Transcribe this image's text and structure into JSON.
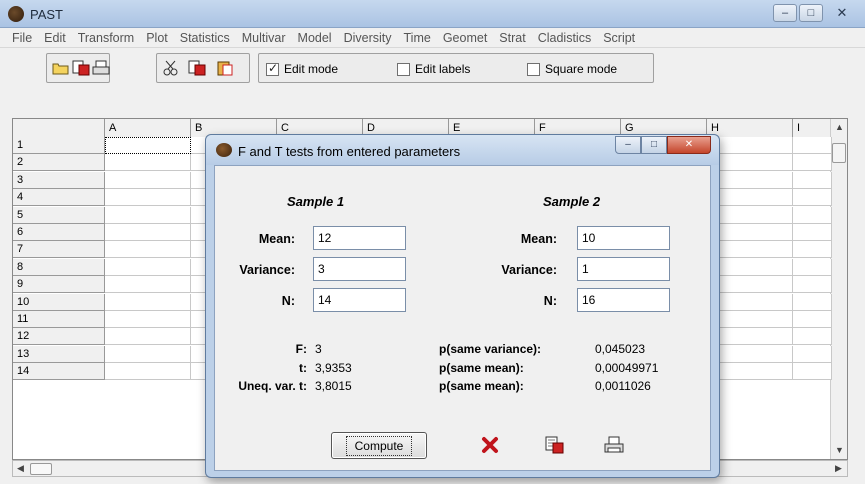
{
  "window": {
    "title": "PAST"
  },
  "menu": [
    "File",
    "Edit",
    "Transform",
    "Plot",
    "Statistics",
    "Multivar",
    "Model",
    "Diversity",
    "Time",
    "Geomet",
    "Strat",
    "Cladistics",
    "Script"
  ],
  "toolbar": {
    "edit_mode": {
      "label": "Edit mode",
      "checked": true
    },
    "edit_labels": {
      "label": "Edit labels",
      "checked": false
    },
    "square_mode": {
      "label": "Square mode",
      "checked": false
    }
  },
  "grid": {
    "columns": [
      "A",
      "B",
      "C",
      "D",
      "E",
      "F",
      "G",
      "H",
      "I"
    ],
    "rows": [
      "1",
      "2",
      "3",
      "4",
      "5",
      "6",
      "7",
      "8",
      "9",
      "10",
      "11",
      "12",
      "13",
      "14"
    ]
  },
  "dialog": {
    "title": "F and T tests from entered parameters",
    "sample1": {
      "header": "Sample 1",
      "mean_label": "Mean:",
      "mean": "12",
      "variance_label": "Variance:",
      "variance": "3",
      "n_label": "N:",
      "n": "14"
    },
    "sample2": {
      "header": "Sample 2",
      "mean_label": "Mean:",
      "mean": "10",
      "variance_label": "Variance:",
      "variance": "1",
      "n_label": "N:",
      "n": "16"
    },
    "results": {
      "f_label": "F:",
      "f": "3",
      "t_label": "t:",
      "t": "3,9353",
      "uneq_label": "Uneq. var. t:",
      "uneq": "3,8015",
      "p_var_label": "p(same variance):",
      "p_var": "0,045023",
      "p_mean_label": "p(same mean):",
      "p_mean": "0,00049971",
      "p_mean2_label": "p(same mean):",
      "p_mean2": "0,0011026"
    },
    "compute_label": "Compute"
  }
}
